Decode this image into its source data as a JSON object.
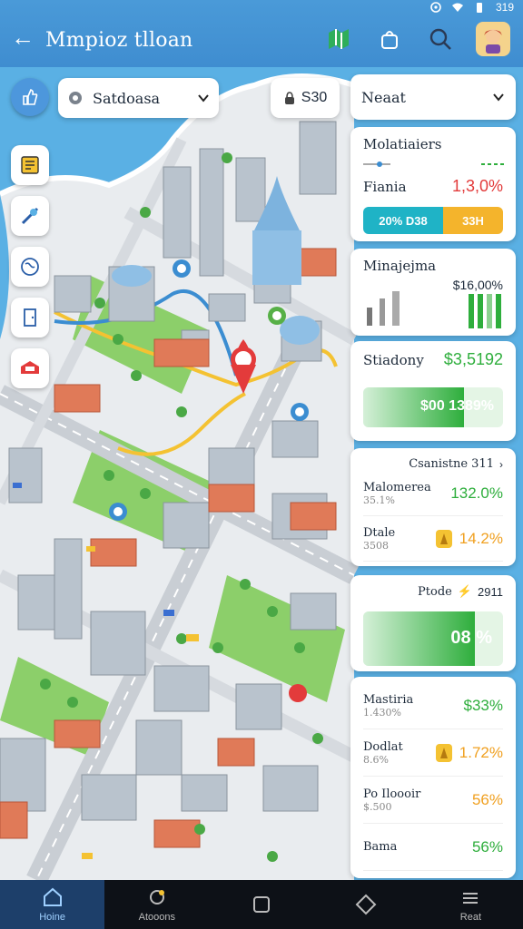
{
  "status": {
    "time": "319"
  },
  "appbar": {
    "title": "Mmpioz tlloan"
  },
  "map": {
    "place_select": "Satdoasa",
    "search_label": "S30",
    "nearby_label": "Neaat"
  },
  "panel": {
    "card1": {
      "title": "Molatiaiers",
      "row_label": "Fiania",
      "row_value": "1,3,0%",
      "pill_left": "20% D38",
      "pill_right": "33H"
    },
    "card2": {
      "title": "Minajejma",
      "value": "$16,00%"
    },
    "card3": {
      "title": "Stiadony",
      "value": "$3,5192",
      "bar_label": "$00 1389%",
      "bar_fill": 0.72
    },
    "card4": {
      "header": "Csanistne 311",
      "rows": [
        {
          "label": "Malomerea",
          "sub": "35.1%",
          "value": "132.0%",
          "color": "green",
          "icon": ""
        },
        {
          "label": "Dtale",
          "sub": "3508",
          "value": "14.2%",
          "color": "orange",
          "icon": "warning-icon"
        }
      ]
    },
    "card5": {
      "header": "Ptode",
      "header_value": "2911",
      "bar_label": "08 %",
      "bar_fill": 0.8
    },
    "card6": {
      "rows": [
        {
          "label": "Mastiria",
          "sub": "1.430%",
          "value": "$33%",
          "color": "green",
          "icon": ""
        },
        {
          "label": "Dodlat",
          "sub": "8.6%",
          "value": "1.72%",
          "color": "orange",
          "icon": "warning-icon"
        },
        {
          "label": "Po Iloooir",
          "sub": "$.500",
          "value": "56%",
          "color": "orange",
          "icon": ""
        },
        {
          "label": "Bama",
          "sub": "",
          "value": "56%",
          "color": "green",
          "icon": ""
        }
      ]
    }
  },
  "nav": [
    {
      "label": "Hoine",
      "icon": "home-icon",
      "active": true
    },
    {
      "label": "Atooons",
      "icon": "actions-icon",
      "active": false
    },
    {
      "label": "",
      "icon": "square-icon",
      "active": false
    },
    {
      "label": "",
      "icon": "diamond-icon",
      "active": false
    },
    {
      "label": "Reat",
      "icon": "stack-icon",
      "active": false
    }
  ],
  "colors": {
    "accent": "#4a9ad8",
    "water": "#5ab0e4",
    "green": "#2eae3c",
    "red": "#e23a3a",
    "orange": "#f0a020"
  }
}
